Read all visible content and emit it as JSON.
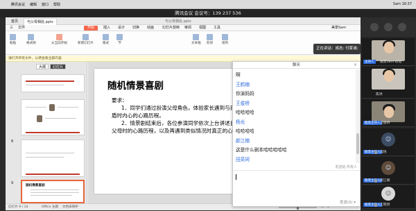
{
  "meeting": {
    "title": "腾讯会议 会议号：139 237 536"
  },
  "macmenu": {
    "apple": "",
    "items": [
      "腾讯会议",
      "编辑",
      "窗口",
      "帮助"
    ],
    "status": "Sam 16:37"
  },
  "wps": {
    "tabs": [
      {
        "label": "首页"
      },
      {
        "label": "与父母相处.pptx"
      }
    ],
    "doc_title": "与父母相处.pptx",
    "menu": [
      "三",
      "文件",
      "开始",
      "插入",
      "设计",
      "切换",
      "动画",
      "幻灯片放映",
      "审阅",
      "视图",
      "工具"
    ],
    "active_menu": "开始",
    "user": "美景Sam",
    "tools": [
      "粘贴",
      "格式刷",
      "从当前开始",
      "新建幻灯片",
      "版式",
      "节",
      "文本框",
      "形状",
      "排列"
    ],
    "notice": "请打开所有文件，以便查看全部内容",
    "panel_tabs": [
      "大纲",
      "幻灯片"
    ],
    "thumb_labels": [
      "8",
      "9"
    ],
    "thumb_title": "随机情景喜剧",
    "slide": {
      "title": "随机情景喜剧",
      "req": "要求：",
      "p1": "1．同学们通过扮演父母角色，体验家长遇到与孩子的矛盾时内心的心路历程。",
      "p2": "2．情景剧结束后，各位参演同学依次上台讲述自己扮演父母时的心路历程，以及再遇到类似情况时真正的心情"
    },
    "status": {
      "slide": "幻灯片 9 / 14",
      "theme": "Office 主题",
      "backup": "文档未保护",
      "zoom": "67 %"
    }
  },
  "chat": {
    "title": "聊天",
    "close": "×",
    "messages": [
      {
        "text": "啊",
        "type": "text"
      },
      {
        "text": "王鹤楠",
        "type": "name"
      },
      {
        "text": "你演妈妈",
        "type": "text"
      },
      {
        "text": "王俊桥",
        "type": "name"
      },
      {
        "text": "哈哈哈哈",
        "type": "text"
      },
      {
        "text": "杨光",
        "type": "name"
      },
      {
        "text": "哈哈哈哈",
        "type": "text"
      },
      {
        "text": "颜江楠",
        "type": "name"
      },
      {
        "text": "这是什么剧本哈哈哈哈哈",
        "type": "text"
      },
      {
        "text": "田英珂",
        "type": "name"
      }
    ],
    "recipient": "发送给 所有人",
    "send_label": "发送(S) ▾",
    "input_value": ""
  },
  "participants": {
    "speaking": "正在讲话：成态; 付家诚;",
    "tiles": [
      {
        "tag": "主持人",
        "name": "美景Sam·初始",
        "kind": "video"
      },
      {
        "tag": "",
        "name": "陈洪",
        "kind": "avatar"
      },
      {
        "tag": "联席主持人",
        "name": "王俊桥",
        "kind": "video"
      },
      {
        "tag": "联席主持人",
        "name": "成悦",
        "kind": "avatar"
      },
      {
        "tag": "联席主持人",
        "name": "颜江楠",
        "kind": "avatar"
      },
      {
        "tag": "联席主持人",
        "name": "王晓然",
        "kind": "avatar"
      }
    ]
  },
  "colors": {
    "accent": "#f4664a",
    "link": "#2d6cdf",
    "dark": "#262626"
  }
}
